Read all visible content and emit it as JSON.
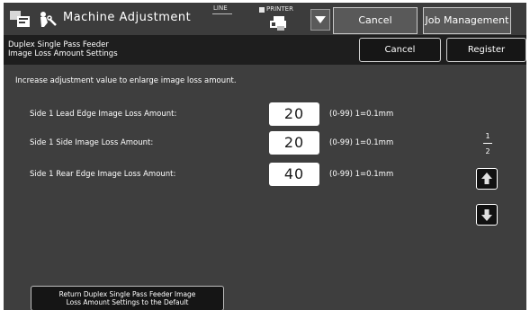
{
  "header": {
    "title": "Machine Adjustment",
    "line_label": "LINE",
    "printer_label": "PRINTER",
    "cancel_label": "Cancel",
    "job_management_label": "Job Management"
  },
  "subheader": {
    "title_line1": "Duplex Single Pass Feeder",
    "title_line2": "Image Loss Amount Settings",
    "cancel_label": "Cancel",
    "register_label": "Register"
  },
  "main": {
    "instruction": "Increase adjustment value to enlarge image loss amount.",
    "settings": [
      {
        "label": "Side 1 Lead Edge Image Loss Amount:",
        "value": "20",
        "range": "(0-99) 1=0.1mm"
      },
      {
        "label": "Side 1 Side Image Loss Amount:",
        "value": "20",
        "range": "(0-99) 1=0.1mm"
      },
      {
        "label": "Side 1 Rear Edge Image Loss Amount:",
        "value": "40",
        "range": "(0-99) 1=0.1mm"
      }
    ],
    "page": {
      "current": "1",
      "total": "2"
    },
    "return_default_line1": "Return Duplex Single Pass Feeder Image",
    "return_default_line2": "Loss Amount Settings to the Default"
  },
  "icons": {
    "app": "home-screen-icon",
    "adjust": "machine-adjustment-icon",
    "printer": "printer-icon",
    "dropdown": "dropdown-triangle-icon",
    "up": "up-arrow-icon",
    "down": "down-arrow-icon"
  },
  "colors": {
    "header_bg": "#3c3c3c",
    "subheader_bg": "#1e1e1e",
    "body_bg": "#3e3e3e",
    "value_box": "#ffffff"
  }
}
